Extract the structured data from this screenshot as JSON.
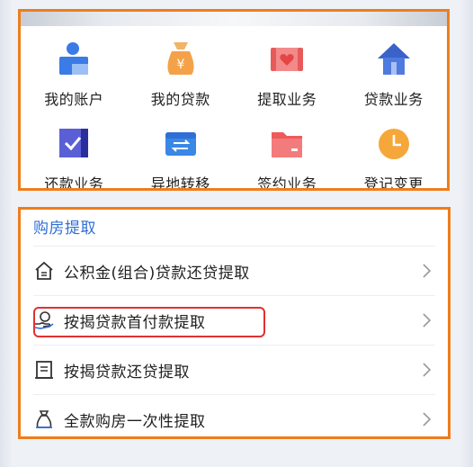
{
  "grid": {
    "items": [
      {
        "label": "我的账户",
        "icon": "account-icon"
      },
      {
        "label": "我的贷款",
        "icon": "money-bag-icon"
      },
      {
        "label": "提取业务",
        "icon": "withdraw-heart-icon"
      },
      {
        "label": "贷款业务",
        "icon": "house-icon"
      },
      {
        "label": "还款业务",
        "icon": "check-box-icon"
      },
      {
        "label": "异地转移",
        "icon": "transfer-icon"
      },
      {
        "label": "签约业务",
        "icon": "folder-icon"
      },
      {
        "label": "登记变更",
        "icon": "clock-icon"
      }
    ]
  },
  "section": {
    "title": "购房提取",
    "items": [
      {
        "label": "公积金(组合)贷款还贷提取",
        "icon": "house-outline-icon"
      },
      {
        "label": "按揭贷款首付款提取",
        "icon": "hand-coin-icon"
      },
      {
        "label": "按揭贷款还贷提取",
        "icon": "document-icon"
      },
      {
        "label": "全款购房一次性提取",
        "icon": "money-bag-outline-icon"
      }
    ]
  },
  "colors": {
    "accent_blue": "#2f6fd6",
    "annotation_orange": "#ef7d1a",
    "highlight_red": "#e03131"
  }
}
